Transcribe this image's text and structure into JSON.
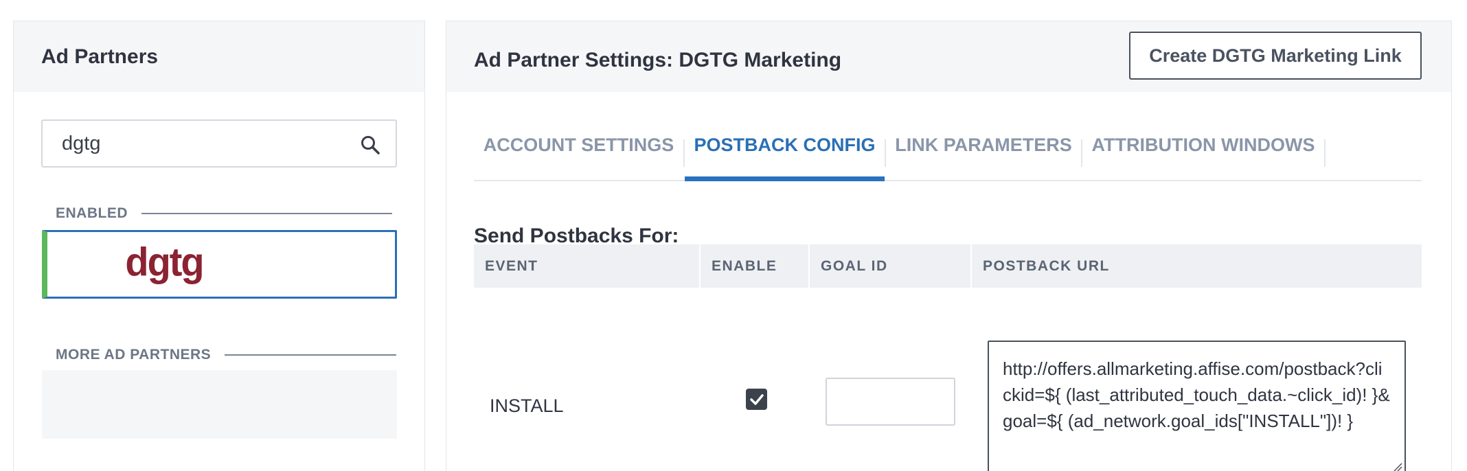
{
  "left": {
    "title": "Ad Partners",
    "search": {
      "value": "dgtg"
    },
    "enabled_label": "ENABLED",
    "enabled_partner": {
      "logo_text": "dgtg",
      "logo_color": "#8b2332"
    },
    "more_label": "MORE AD PARTNERS"
  },
  "right": {
    "title": "Ad Partner Settings: DGTG Marketing",
    "create_button": "Create DGTG Marketing Link",
    "tabs": [
      {
        "label": "ACCOUNT SETTINGS",
        "active": false
      },
      {
        "label": "POSTBACK CONFIG",
        "active": true
      },
      {
        "label": "LINK PARAMETERS",
        "active": false
      },
      {
        "label": "ATTRIBUTION WINDOWS",
        "active": false
      }
    ],
    "send_label": "Send Postbacks For:",
    "table": {
      "headers": [
        "EVENT",
        "ENABLE",
        "GOAL ID",
        "POSTBACK URL"
      ],
      "rows": [
        {
          "event": "INSTALL",
          "enabled": true,
          "goal_id": "",
          "postback_url": "http://offers.allmarketing.affise.com/postback?clickid=${ (last_attributed_touch_data.~click_id)! }&goal=${ (ad_network.goal_ids[\"INSTALL\"])! }"
        }
      ]
    }
  },
  "colors": {
    "accent": "#2a72c1",
    "enabled_bar": "#5cb85c",
    "header_bg": "#f5f6f8",
    "tab_inactive": "#8a96a8"
  },
  "icons": [
    "search-icon",
    "check-icon",
    "resize-handle-icon"
  ]
}
